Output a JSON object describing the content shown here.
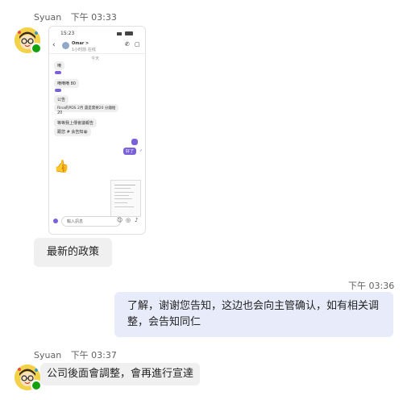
{
  "messages": [
    {
      "sender": "Syuan",
      "time": "下午 03:33",
      "screenshot": {
        "status_time": "15:23",
        "contact_name": "Omar >",
        "contact_sub": "1小时前 在线",
        "day_label": "今天",
        "date_tag": "嘀",
        "lines": [
          "嘀嘀嘀 80",
          "公告",
          "Rina的PDS 2月 還是需要20 分鐘給",
          "20",
          "等等我上傳會議報告",
          "跟您 # 会告知😀"
        ],
        "my_reply": "好了",
        "input_placeholder": "輸入訊息"
      },
      "text": "最新的政策"
    },
    {
      "time": "下午 03:36",
      "text": "了解，谢谢您告知，这边也会向主管确认，如有相关调整，会告知同仁"
    },
    {
      "sender": "Syuan",
      "time": "下午 03:37",
      "text": "公司後面會調整，會再進行宣達"
    }
  ],
  "colors": {
    "self_bubble": "#e8ebfa",
    "other_bubble": "#f0f0f0",
    "presence": "#13a10e",
    "accent": "#7b61d9"
  }
}
